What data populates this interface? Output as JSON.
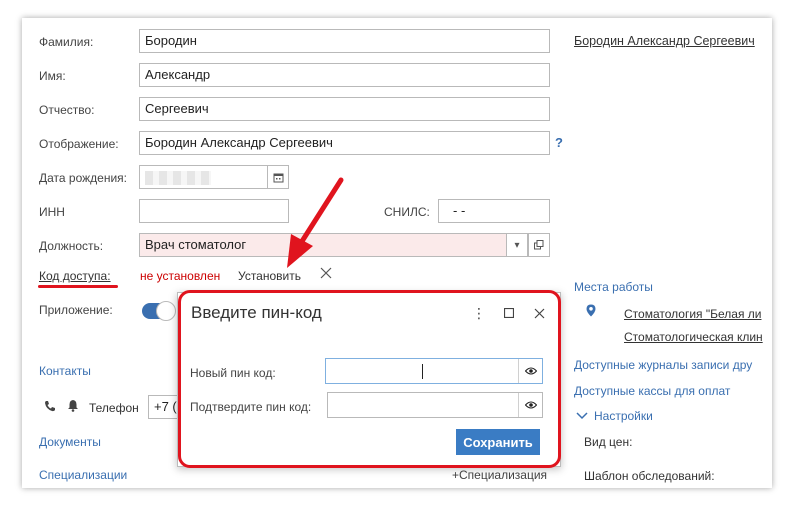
{
  "form": {
    "lastname_label": "Фамилия:",
    "lastname_value": "Бородин",
    "firstname_label": "Имя:",
    "firstname_value": "Александр",
    "patronymic_label": "Отчество:",
    "patronymic_value": "Сергеевич",
    "display_label": "Отображение:",
    "display_value": "Бородин Александр Сергеевич",
    "help": "?",
    "birthdate_label": "Дата рождения:",
    "inn_label": "ИНН",
    "snils_label": "СНИЛС:",
    "snils_value": "-   -",
    "position_label": "Должность:",
    "position_value": "Врач стоматолог",
    "access_code_label": "Код доступа:",
    "access_code_status": "не установлен",
    "access_code_set": "Установить",
    "app_label": "Приложение:",
    "contacts": "Контакты",
    "phone_label": "Телефон",
    "phone_value": "+7 (",
    "documents": "Документы",
    "specializations": "Специализации",
    "add_specialization": "+Специализация"
  },
  "right": {
    "fullname_link": "Бородин Александр Сергеевич",
    "workplaces": "Места работы",
    "workplace_1": "Стоматология \"Белая ли",
    "workplace_2": "Стоматологическая клин",
    "journals": "Доступные журналы записи дру",
    "cashboxes": "Доступные кассы для оплат",
    "settings": "Настройки",
    "price_type": "Вид цен:",
    "exam_template": "Шаблон обследований:"
  },
  "modal": {
    "title": "Введите пин-код",
    "new_pin_label": "Новый пин код:",
    "confirm_pin_label": "Подтвердите пин код:",
    "save": "Сохранить"
  },
  "colors": {
    "accent": "#3a6fb0",
    "highlight_red": "#e0141e",
    "error_text": "#cc0000"
  }
}
